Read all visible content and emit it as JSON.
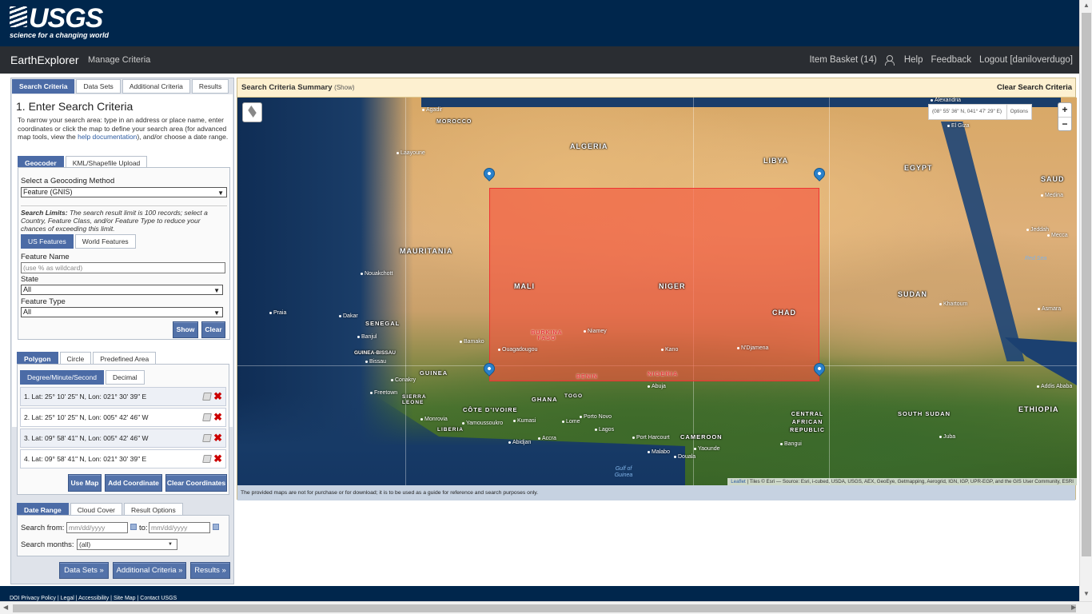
{
  "header": {
    "logo_text": "USGS",
    "logo_tagline": "science for a changing world",
    "app_name": "EarthExplorer",
    "manage_criteria": "Manage Criteria",
    "nav": {
      "item_basket": "Item Basket (14)",
      "help": "Help",
      "feedback": "Feedback",
      "logout": "Logout [daniloverdugo]"
    }
  },
  "left_panel": {
    "tabs": [
      "Search Criteria",
      "Data Sets",
      "Additional Criteria",
      "Results"
    ],
    "title": "1. Enter Search Criteria",
    "intro_before_link": "To narrow your search area: type in an address or place name, enter coordinates or click the map to define your search area (for advanced map tools, view the ",
    "intro_link": "help documentation",
    "intro_after_link": "), and/or choose a date range.",
    "geo_tabs": [
      "Geocoder",
      "KML/Shapefile Upload"
    ],
    "geocoding_label": "Select a Geocoding Method",
    "geocoding_value": "Feature (GNIS)",
    "search_limits_bold": "Search Limits:",
    "search_limits_text": " The search result limit is 100 records; select a Country, Feature Class, and/or Feature Type to reduce your chances of exceeding this limit.",
    "feature_tabs": [
      "US Features",
      "World Features"
    ],
    "feature_name_label": "Feature Name",
    "feature_name_placeholder": "(use % as wildcard)",
    "state_label": "State",
    "state_value": "All",
    "feature_type_label": "Feature Type",
    "feature_type_value": "All",
    "show_button": "Show",
    "clear_button": "Clear",
    "area_tabs": [
      "Polygon",
      "Circle",
      "Predefined Area"
    ],
    "format_tabs": [
      "Degree/Minute/Second",
      "Decimal"
    ],
    "coordinates": [
      "1.  Lat: 25° 10' 25\" N, Lon: 021° 30' 39\" E",
      "2.  Lat: 25° 10' 25\" N, Lon: 005° 42' 46\" W",
      "3.  Lat: 09° 58' 41\" N, Lon: 005° 42' 46\" W",
      "4.  Lat: 09° 58' 41\" N, Lon: 021° 30' 39\" E"
    ],
    "use_map_button": "Use Map",
    "add_coordinate_button": "Add Coordinate",
    "clear_coordinates_button": "Clear Coordinates",
    "date_tabs": [
      "Date Range",
      "Cloud Cover",
      "Result Options"
    ],
    "search_from_label": "Search from:",
    "search_from_placeholder": "mm/dd/yyyy",
    "to_label": "to:",
    "to_placeholder": "mm/dd/yyyy",
    "search_months_label": "Search months:",
    "search_months_value": "(all)",
    "bottom_buttons": [
      "Data Sets »",
      "Additional Criteria »",
      "Results »"
    ]
  },
  "map": {
    "summary_title": "Search Criteria Summary",
    "summary_show": "(Show)",
    "clear_search": "Clear Search Criteria",
    "coord_readout": "(08° 55' 36\" N, 041° 47' 29\" E)",
    "options": "Options",
    "zoom_in": "+",
    "zoom_out": "−",
    "attribution_link": "Leaflet",
    "attribution_text": " | Tiles © Esri — Source: Esri, i-cubed, USDA, USGS, AEX, GeoEye, Getmapping, Aerogrid, IGN, IGP, UPR-EGP, and the GIS User Community, ESRI",
    "disclaimer": "The provided maps are not for purchase or for download; it is to be used as a guide for reference and search purposes only.",
    "countries": [
      "MOROCCO",
      "ALGERIA",
      "LIBYA",
      "EGYPT",
      "SAUD",
      "MAURITANIA",
      "MALI",
      "NIGER",
      "CHAD",
      "SUDAN",
      "SENEGAL",
      "GUINEA-BISSAU",
      "GUINEA",
      "BURKINA FASO",
      "BENIN",
      "NIGERIA",
      "GHANA",
      "TOGO",
      "SIERRA LEONE",
      "LIBERIA",
      "CÔTE D'IVOIRE",
      "CAMEROON",
      "CENTRAL AFRICAN REPUBLIC",
      "SOUTH SUDAN",
      "ETHIOPIA"
    ],
    "cities": [
      "Agadir",
      "Laayoune",
      "Nouakchott",
      "Dakar",
      "Praia",
      "Banjul",
      "Bissau",
      "Conakry",
      "Freetown",
      "Monrovia",
      "Bamako",
      "Niamey",
      "Ouagadougou",
      "Kano",
      "N'Djamena",
      "Abuja",
      "Kumasi",
      "Accra",
      "Lome",
      "Porto Novo",
      "Lagos",
      "Abidjan",
      "Yamoussoukro",
      "Port Harcourt",
      "Malabo",
      "Yaounde",
      "Douala",
      "Bangui",
      "Khartoum",
      "Asmara",
      "Juba",
      "Addis Ababa",
      "Jeddah",
      "Mecca",
      "Medina",
      "El Giza",
      "Alexandria"
    ],
    "seas": [
      "Red Sea",
      "Gulf of Guinea"
    ]
  },
  "footer": {
    "links": "DOI Privacy Policy  |  Legal  |  Accessibility  |  Site Map  |  Contact USGS"
  }
}
